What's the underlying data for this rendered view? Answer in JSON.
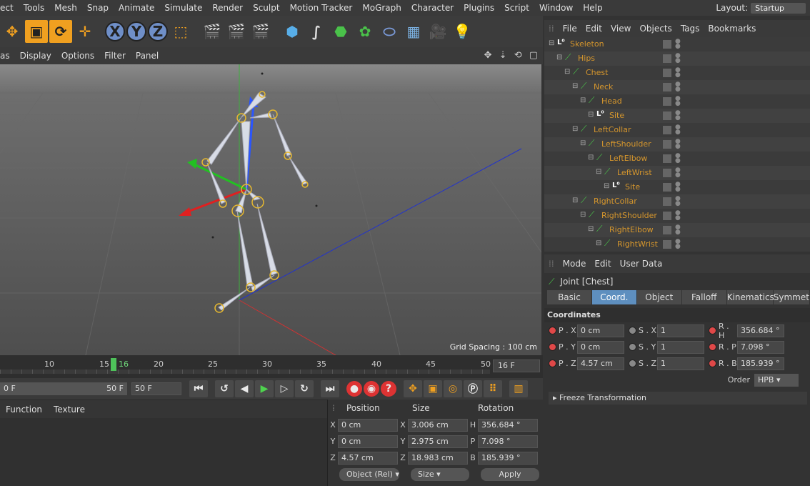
{
  "menu": [
    "ect",
    "Tools",
    "Mesh",
    "Snap",
    "Animate",
    "Simulate",
    "Render",
    "Sculpt",
    "Motion Tracker",
    "MoGraph",
    "Character",
    "Plugins",
    "Script",
    "Window",
    "Help"
  ],
  "layout": {
    "label": "Layout:",
    "value": "Startup"
  },
  "toolbar": {
    "icons": [
      "move-icon",
      "scale-icon",
      "rotate-icon",
      "live-select-icon",
      "x-axis-icon",
      "y-axis-icon",
      "z-axis-icon",
      "coord-system-icon",
      "render-view-icon",
      "render-picture-queue-icon",
      "render-settings-icon",
      "cube-icon",
      "spline-pen-icon",
      "subdivision-icon",
      "cloner-icon",
      "deformer-icon",
      "floor-icon",
      "camera-icon",
      "light-icon"
    ],
    "axis_labels": [
      "X",
      "Y",
      "Z"
    ]
  },
  "viewport": {
    "menu": [
      "as",
      "Display",
      "Options",
      "Filter",
      "Panel"
    ],
    "nav_icons": "✥ ⇣ ⟲ ▢",
    "grid_spacing": "Grid Spacing : 100 cm"
  },
  "timeline": {
    "ticks": [
      "10",
      "15",
      "20",
      "25",
      "30",
      "35",
      "40",
      "45",
      "50"
    ],
    "current_frame": "16",
    "frame_field": "16 F"
  },
  "transport": {
    "start_field": "0 F",
    "end_field": "50 F",
    "end_field_right": "50 F",
    "buttons": [
      "⏮",
      "⟲",
      "◀",
      "▶",
      "▶",
      "⟳",
      "⏭"
    ]
  },
  "materials": {
    "menu": [
      "Function",
      "Texture"
    ]
  },
  "coords": {
    "headers": [
      "Position",
      "Size",
      "Rotation"
    ],
    "rows": [
      {
        "axis": "X",
        "pos": "0 cm",
        "size_axis": "X",
        "size": "3.006 cm",
        "rot_axis": "H",
        "rot": "356.684 °"
      },
      {
        "axis": "Y",
        "pos": "0 cm",
        "size_axis": "Y",
        "size": "2.975 cm",
        "rot_axis": "P",
        "rot": "7.098 °"
      },
      {
        "axis": "Z",
        "pos": "4.57 cm",
        "size_axis": "Z",
        "size": "18.983 cm",
        "rot_axis": "B",
        "rot": "185.939 °"
      }
    ],
    "mode_select": "Object (Rel)",
    "size_select": "Size",
    "apply_label": "Apply"
  },
  "object_manager": {
    "menu": [
      "File",
      "Edit",
      "View",
      "Objects",
      "Tags",
      "Bookmarks"
    ],
    "objects": [
      {
        "name": "Skeleton",
        "indent": 0,
        "type": "null"
      },
      {
        "name": "Hips",
        "indent": 1,
        "type": "joint"
      },
      {
        "name": "Chest",
        "indent": 2,
        "type": "joint"
      },
      {
        "name": "Neck",
        "indent": 3,
        "type": "joint"
      },
      {
        "name": "Head",
        "indent": 4,
        "type": "joint"
      },
      {
        "name": "Site",
        "indent": 5,
        "type": "null"
      },
      {
        "name": "LeftCollar",
        "indent": 3,
        "type": "joint"
      },
      {
        "name": "LeftShoulder",
        "indent": 4,
        "type": "joint"
      },
      {
        "name": "LeftElbow",
        "indent": 5,
        "type": "joint"
      },
      {
        "name": "LeftWrist",
        "indent": 6,
        "type": "joint"
      },
      {
        "name": "Site",
        "indent": 7,
        "type": "null"
      },
      {
        "name": "RightCollar",
        "indent": 3,
        "type": "joint"
      },
      {
        "name": "RightShoulder",
        "indent": 4,
        "type": "joint"
      },
      {
        "name": "RightElbow",
        "indent": 5,
        "type": "joint"
      },
      {
        "name": "RightWrist",
        "indent": 6,
        "type": "joint"
      }
    ]
  },
  "attributes": {
    "menu": [
      "Mode",
      "Edit",
      "User Data"
    ],
    "title": "Joint [Chest]",
    "tabs": [
      "Basic",
      "Coord.",
      "Object",
      "Falloff",
      "Kinematics",
      "Symmet"
    ],
    "active_tab": "Coord.",
    "section": "Coordinates",
    "rows": [
      {
        "p_label": "P . X",
        "p": "0 cm",
        "s_label": "S . X",
        "s": "1",
        "r_label": "R . H",
        "r": "356.684 °"
      },
      {
        "p_label": "P . Y",
        "p": "0 cm",
        "s_label": "S . Y",
        "s": "1",
        "r_label": "R . P",
        "r": "7.098 °"
      },
      {
        "p_label": "P . Z",
        "p": "4.57 cm",
        "s_label": "S . Z",
        "s": "1",
        "r_label": "R . B",
        "r": "185.939 °"
      }
    ],
    "order_label": "Order",
    "order_value": "HPB",
    "freeze": "Freeze Transformation"
  }
}
